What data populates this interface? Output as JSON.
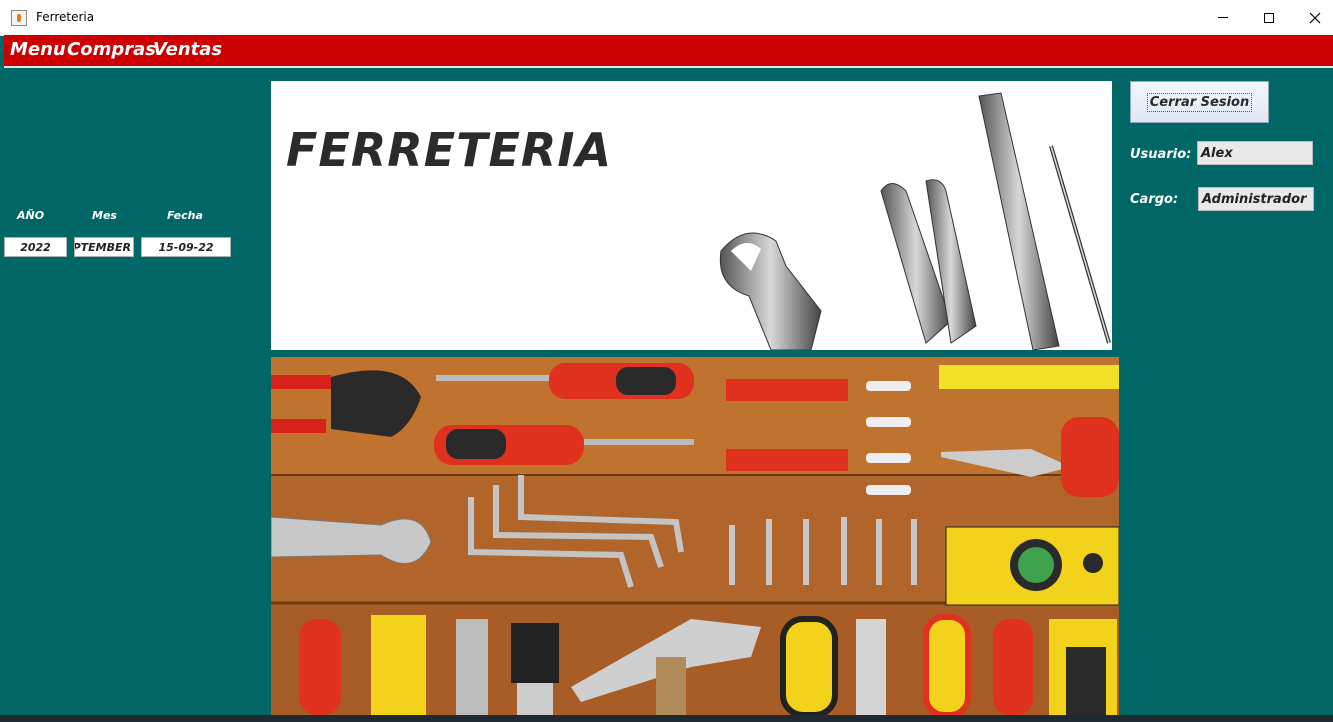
{
  "window": {
    "title": "Ferreteria"
  },
  "menu": {
    "items": [
      "Menu",
      "Compras",
      "Ventas"
    ]
  },
  "date_panel": {
    "year_label": "AÑO",
    "month_label": "Mes",
    "date_label": "Fecha",
    "year_value": "2022",
    "month_value": "SEPTEMBER",
    "date_value": "15-09-22"
  },
  "banner": {
    "title": "FERRETERIA"
  },
  "session": {
    "logout_label": "Cerrar Sesion",
    "user_label": "Usuario:",
    "user_value": "Alex",
    "role_label": "Cargo:",
    "role_value": "Administrador"
  },
  "colors": {
    "background": "#006666",
    "menubar": "#cc0000"
  }
}
